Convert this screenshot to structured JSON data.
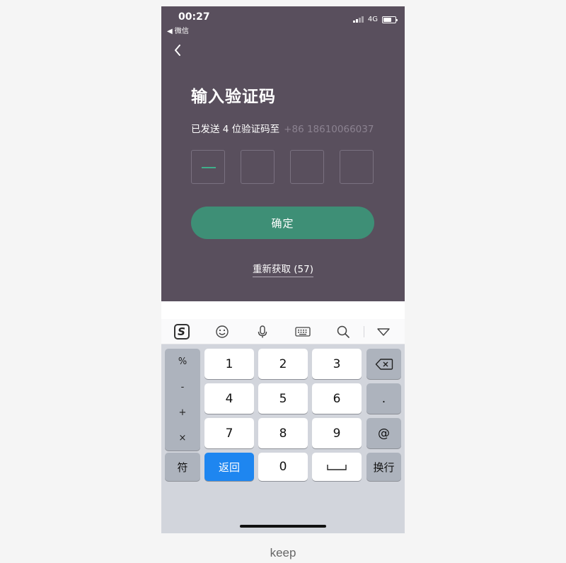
{
  "status_bar": {
    "time": "00:27",
    "back_app": "◀ 微信",
    "network": "4G"
  },
  "page": {
    "title": "输入验证码",
    "sent_prefix": "已发送 4 位验证码至",
    "phone_number": "+86 18610066037",
    "code_digits": [
      "",
      "",
      "",
      ""
    ],
    "confirm_label": "确定",
    "resend_label": "重新获取 (57)"
  },
  "keyboard": {
    "toolbar_icons": [
      "sogou-logo-icon",
      "emoji-icon",
      "microphone-icon",
      "keyboard-icon",
      "search-icon",
      "collapse-icon"
    ],
    "sogou_letter": "S",
    "symbols": [
      "%",
      "-",
      "+",
      "×"
    ],
    "digits": [
      "1",
      "2",
      "3",
      "4",
      "5",
      "6",
      "7",
      "8",
      "9",
      "0"
    ],
    "dot": ".",
    "at": "@",
    "fu_label": "符",
    "return_label": "返回",
    "newline_label": "换行"
  },
  "caption": "keep",
  "colors": {
    "app_bg": "#594f5d",
    "accent_green": "#3e8f76",
    "cursor_green": "#3fae8b",
    "keyboard_blue": "#1e86f0"
  }
}
